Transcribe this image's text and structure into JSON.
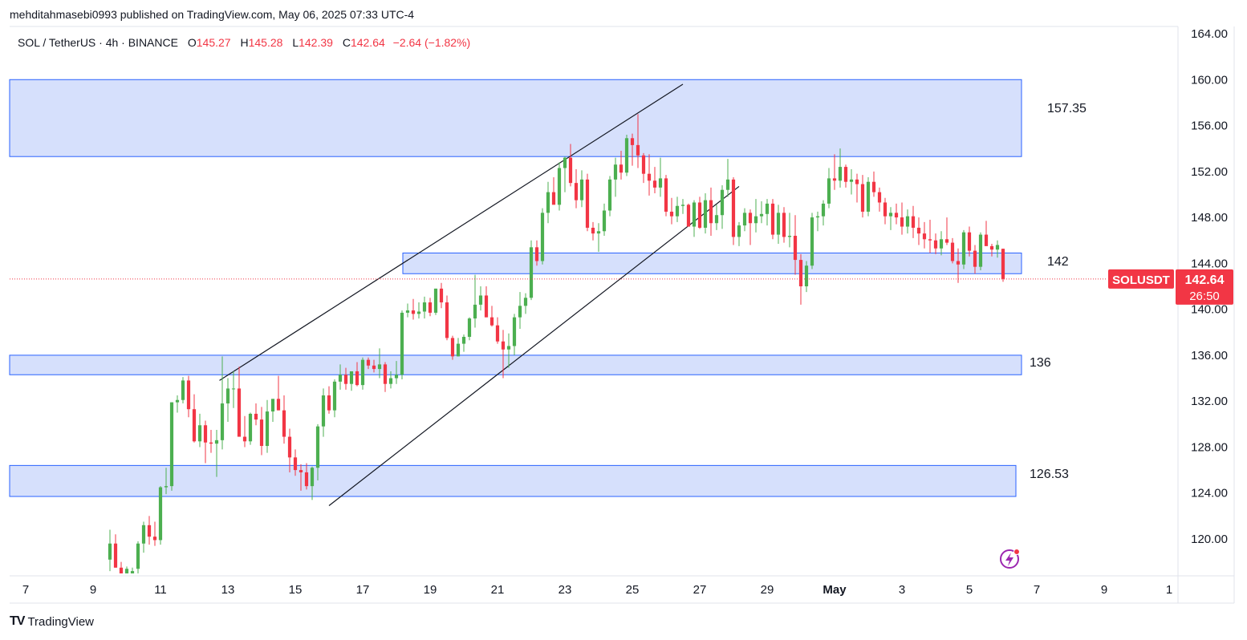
{
  "header": {
    "published": "mehditahmasebi0993 published on TradingView.com, May 06, 2025 07:33 UTC-4"
  },
  "legend": {
    "symbol": "SOL / TetherUS · 4h · BINANCE",
    "o_label": "O",
    "o": "145.27",
    "h_label": "H",
    "h": "145.28",
    "l_label": "L",
    "l": "142.39",
    "c_label": "C",
    "c": "142.64",
    "change": "−2.64 (−1.82%)"
  },
  "footer": {
    "brand": "TradingView",
    "logo": "TV"
  },
  "colors": {
    "up": "#089981",
    "up_fill": "#4caf50",
    "down": "#f23645",
    "zone_fill": "#d6e0fc",
    "zone_stroke": "#2962ff",
    "price_tag": "#f23645"
  },
  "chart_data": {
    "type": "candlestick",
    "title": "SOL / TetherUS · 4h · BINANCE",
    "ylim": [
      117,
      165
    ],
    "y_ticks": [
      "164.00",
      "160.00",
      "156.00",
      "152.00",
      "148.00",
      "144.00",
      "140.00",
      "136.00",
      "132.00",
      "128.00",
      "124.00",
      "120.00"
    ],
    "x_tick_labels": [
      "7",
      "9",
      "11",
      "13",
      "15",
      "17",
      "19",
      "21",
      "23",
      "25",
      "27",
      "29",
      "May",
      "3",
      "5",
      "7",
      "9",
      "1"
    ],
    "current_price": {
      "label": "SOLUSDT",
      "value": "142.64",
      "countdown": "26:50",
      "price": 142.64
    },
    "zones": [
      {
        "low": 153.3,
        "high": 160.0,
        "label": "157.35"
      },
      {
        "low": 143.1,
        "high": 144.9,
        "label": "142"
      },
      {
        "low": 134.3,
        "high": 136.0,
        "label": "136"
      },
      {
        "low": 123.7,
        "high": 126.4,
        "label": "126.53"
      }
    ],
    "trendlines": [
      {
        "from": [
          "Apr 12 18:00",
          133.8
        ],
        "to": [
          "Apr 26 12:00",
          159.6
        ]
      },
      {
        "from": [
          "Apr 16 00:00",
          122.9
        ],
        "to": [
          "Apr 28 04:00",
          150.7
        ]
      }
    ],
    "candles": [
      [
        118.2,
        120.8,
        117.2,
        119.6
      ],
      [
        119.6,
        120.4,
        117.5,
        117.5
      ],
      [
        117.5,
        118.0,
        116.2,
        117.0
      ],
      [
        117.0,
        117.6,
        116.5,
        117.4
      ],
      [
        117.0,
        117.5,
        116.3,
        117.2
      ],
      [
        117.4,
        119.8,
        117.0,
        119.6
      ],
      [
        119.6,
        121.5,
        118.8,
        121.2
      ],
      [
        121.2,
        122.0,
        119.5,
        120.2
      ],
      [
        120.2,
        121.5,
        119.4,
        119.9
      ],
      [
        119.9,
        124.6,
        119.5,
        124.5
      ],
      [
        124.5,
        126.2,
        123.9,
        124.6
      ],
      [
        124.6,
        131.9,
        124.2,
        131.9
      ],
      [
        131.9,
        132.5,
        131.0,
        132.1
      ],
      [
        132.1,
        134.1,
        131.8,
        133.8
      ],
      [
        133.8,
        134.2,
        130.6,
        131.3
      ],
      [
        131.3,
        132.6,
        128.4,
        128.5
      ],
      [
        128.5,
        130.9,
        128.0,
        129.9
      ],
      [
        129.9,
        130.3,
        126.6,
        128.4
      ],
      [
        128.4,
        129.5,
        127.5,
        128.3
      ],
      [
        128.3,
        129.5,
        125.4,
        128.6
      ],
      [
        128.6,
        135.9,
        127.8,
        131.8
      ],
      [
        131.8,
        134.0,
        130.2,
        133.1
      ],
      [
        133.1,
        134.6,
        131.4,
        133.1
      ],
      [
        133.1,
        135.0,
        130.5,
        128.9
      ],
      [
        128.9,
        130.7,
        128.0,
        128.5
      ],
      [
        128.5,
        131.0,
        128.2,
        130.9
      ],
      [
        130.9,
        131.8,
        129.9,
        130.4
      ],
      [
        130.4,
        131.5,
        127.3,
        128.1
      ],
      [
        128.1,
        132.1,
        127.5,
        131.1
      ],
      [
        131.1,
        132.0,
        130.2,
        132.2
      ],
      [
        132.2,
        134.2,
        131.2,
        131.2
      ],
      [
        131.2,
        132.5,
        128.3,
        128.9
      ],
      [
        128.9,
        129.6,
        125.8,
        127.1
      ],
      [
        127.1,
        127.8,
        125.5,
        126.0
      ],
      [
        126.0,
        126.5,
        124.2,
        125.8
      ],
      [
        125.8,
        126.6,
        124.3,
        124.6
      ],
      [
        124.6,
        126.3,
        123.4,
        126.2
      ],
      [
        126.2,
        130.0,
        125.1,
        129.8
      ],
      [
        129.8,
        133.1,
        128.9,
        132.5
      ],
      [
        132.5,
        133.3,
        130.9,
        131.2
      ],
      [
        131.2,
        133.9,
        130.6,
        133.7
      ],
      [
        133.7,
        135.2,
        133.0,
        134.3
      ],
      [
        134.3,
        134.9,
        133.0,
        133.5
      ],
      [
        133.5,
        134.6,
        132.9,
        134.6
      ],
      [
        134.6,
        135.4,
        133.3,
        133.4
      ],
      [
        133.4,
        135.8,
        133.0,
        135.6
      ],
      [
        135.6,
        135.8,
        134.8,
        135.1
      ],
      [
        135.1,
        135.6,
        134.5,
        134.8
      ],
      [
        134.8,
        136.6,
        134.0,
        135.2
      ],
      [
        135.2,
        135.4,
        132.8,
        133.5
      ],
      [
        133.5,
        134.6,
        133.1,
        134.0
      ],
      [
        134.0,
        135.5,
        133.5,
        134.3
      ],
      [
        134.3,
        139.9,
        133.9,
        139.7
      ],
      [
        139.7,
        140.5,
        139.3,
        139.9
      ],
      [
        139.9,
        140.9,
        139.1,
        139.6
      ],
      [
        139.6,
        140.6,
        139.2,
        139.8
      ],
      [
        139.8,
        141.1,
        139.2,
        140.6
      ],
      [
        140.6,
        141.0,
        139.4,
        139.7
      ],
      [
        139.7,
        141.8,
        139.5,
        141.8
      ],
      [
        141.8,
        142.3,
        140.1,
        140.6
      ],
      [
        140.6,
        141.2,
        137.3,
        137.5
      ],
      [
        137.5,
        137.7,
        135.6,
        135.9
      ],
      [
        135.9,
        137.5,
        135.9,
        137.0
      ],
      [
        137.0,
        137.8,
        136.3,
        137.6
      ],
      [
        137.6,
        139.3,
        137.3,
        139.2
      ],
      [
        139.2,
        143.0,
        138.4,
        140.4
      ],
      [
        140.4,
        142.0,
        139.9,
        141.2
      ],
      [
        141.2,
        142.0,
        139.3,
        139.3
      ],
      [
        139.3,
        140.3,
        138.5,
        138.6
      ],
      [
        138.6,
        139.3,
        137.0,
        137.2
      ],
      [
        137.2,
        138.2,
        134.0,
        136.5
      ],
      [
        136.5,
        137.9,
        134.9,
        136.8
      ],
      [
        136.8,
        139.6,
        136.0,
        139.3
      ],
      [
        139.3,
        141.5,
        138.3,
        140.3
      ],
      [
        140.3,
        141.4,
        139.6,
        141.0
      ],
      [
        141.0,
        146.0,
        140.8,
        145.4
      ],
      [
        145.4,
        146.0,
        143.8,
        144.2
      ],
      [
        144.2,
        148.8,
        143.9,
        148.4
      ],
      [
        148.4,
        151.1,
        147.5,
        150.2
      ],
      [
        150.2,
        151.5,
        149.3,
        149.1
      ],
      [
        149.1,
        152.8,
        148.6,
        152.3
      ],
      [
        152.3,
        153.3,
        150.2,
        153.2
      ],
      [
        153.2,
        154.4,
        150.7,
        151.0
      ],
      [
        151.0,
        152.2,
        148.8,
        149.5
      ],
      [
        149.5,
        152.1,
        148.9,
        151.3
      ],
      [
        151.3,
        151.8,
        146.8,
        147.1
      ],
      [
        147.1,
        147.6,
        146.0,
        146.6
      ],
      [
        146.6,
        147.5,
        145.0,
        146.8
      ],
      [
        146.8,
        149.2,
        146.4,
        148.6
      ],
      [
        148.6,
        151.6,
        148.1,
        151.3
      ],
      [
        151.3,
        153.2,
        149.8,
        152.6
      ],
      [
        152.6,
        153.8,
        151.3,
        151.9
      ],
      [
        151.9,
        155.2,
        151.6,
        154.9
      ],
      [
        154.9,
        155.3,
        152.5,
        154.3
      ],
      [
        154.3,
        157.0,
        152.3,
        153.4
      ],
      [
        153.4,
        153.6,
        151.0,
        151.8
      ],
      [
        151.8,
        153.5,
        149.9,
        151.2
      ],
      [
        151.2,
        152.4,
        150.1,
        150.6
      ],
      [
        150.6,
        153.2,
        149.8,
        151.4
      ],
      [
        151.4,
        151.7,
        148.1,
        148.5
      ],
      [
        148.5,
        149.7,
        147.4,
        148.1
      ],
      [
        148.1,
        149.8,
        147.6,
        149.0
      ],
      [
        149.0,
        149.6,
        148.3,
        149.1
      ],
      [
        149.1,
        149.2,
        147.4,
        147.2
      ],
      [
        147.2,
        149.5,
        146.3,
        149.3
      ],
      [
        149.3,
        149.8,
        147.0,
        147.1
      ],
      [
        147.1,
        150.1,
        146.6,
        149.5
      ],
      [
        149.5,
        150.6,
        146.4,
        147.5
      ],
      [
        147.5,
        149.1,
        146.9,
        148.2
      ],
      [
        148.2,
        150.8,
        147.0,
        150.4
      ],
      [
        150.4,
        153.1,
        149.8,
        151.3
      ],
      [
        151.3,
        151.5,
        145.6,
        146.3
      ],
      [
        146.3,
        147.6,
        145.5,
        147.3
      ],
      [
        147.3,
        148.8,
        146.8,
        148.4
      ],
      [
        148.4,
        148.7,
        145.6,
        147.5
      ],
      [
        147.5,
        149.6,
        146.7,
        148.1
      ],
      [
        148.1,
        149.4,
        147.5,
        148.3
      ],
      [
        148.3,
        149.6,
        147.3,
        149.2
      ],
      [
        149.2,
        149.6,
        146.1,
        146.5
      ],
      [
        146.5,
        149.1,
        145.7,
        148.4
      ],
      [
        148.4,
        148.9,
        145.8,
        146.3
      ],
      [
        146.3,
        148.4,
        145.4,
        146.4
      ],
      [
        146.4,
        148.2,
        143.0,
        144.3
      ],
      [
        144.3,
        144.8,
        140.4,
        142.0
      ],
      [
        142.0,
        144.2,
        141.5,
        143.8
      ],
      [
        143.8,
        148.4,
        143.5,
        148.0
      ],
      [
        148.0,
        148.5,
        146.8,
        148.1
      ],
      [
        148.1,
        149.5,
        147.3,
        149.2
      ],
      [
        149.2,
        152.3,
        148.8,
        151.4
      ],
      [
        151.4,
        153.5,
        150.4,
        151.2
      ],
      [
        151.2,
        154.0,
        150.6,
        152.4
      ],
      [
        152.4,
        152.6,
        150.6,
        151.1
      ],
      [
        151.1,
        152.2,
        150.0,
        151.3
      ],
      [
        151.3,
        151.8,
        149.3,
        150.9
      ],
      [
        150.9,
        151.7,
        148.0,
        148.5
      ],
      [
        148.5,
        151.5,
        148.1,
        151.1
      ],
      [
        151.1,
        152.0,
        149.8,
        150.2
      ],
      [
        150.2,
        150.6,
        148.5,
        149.3
      ],
      [
        149.3,
        149.7,
        147.4,
        148.1
      ],
      [
        148.1,
        148.9,
        146.9,
        148.4
      ],
      [
        148.4,
        149.2,
        147.4,
        148.0
      ],
      [
        148.0,
        149.3,
        146.5,
        147.2
      ],
      [
        147.2,
        148.7,
        146.6,
        148.1
      ],
      [
        148.1,
        149.0,
        146.2,
        147.1
      ],
      [
        147.1,
        148.0,
        145.6,
        146.6
      ],
      [
        146.6,
        147.6,
        145.3,
        146.1
      ],
      [
        146.1,
        147.8,
        144.9,
        146.0
      ],
      [
        146.0,
        146.6,
        144.8,
        145.3
      ],
      [
        145.3,
        146.8,
        144.7,
        146.1
      ],
      [
        146.1,
        148.0,
        145.6,
        145.8
      ],
      [
        145.8,
        146.2,
        144.0,
        144.2
      ],
      [
        144.2,
        145.3,
        142.3,
        143.9
      ],
      [
        143.9,
        146.9,
        143.5,
        146.7
      ],
      [
        146.7,
        147.2,
        144.6,
        145.1
      ],
      [
        145.1,
        145.6,
        143.1,
        143.7
      ],
      [
        143.7,
        146.7,
        143.4,
        146.5
      ],
      [
        146.5,
        147.7,
        145.8,
        145.5
      ],
      [
        145.5,
        145.7,
        144.6,
        145.2
      ],
      [
        145.2,
        146.0,
        144.5,
        145.6
      ],
      [
        145.27,
        145.28,
        142.39,
        142.64
      ]
    ]
  }
}
